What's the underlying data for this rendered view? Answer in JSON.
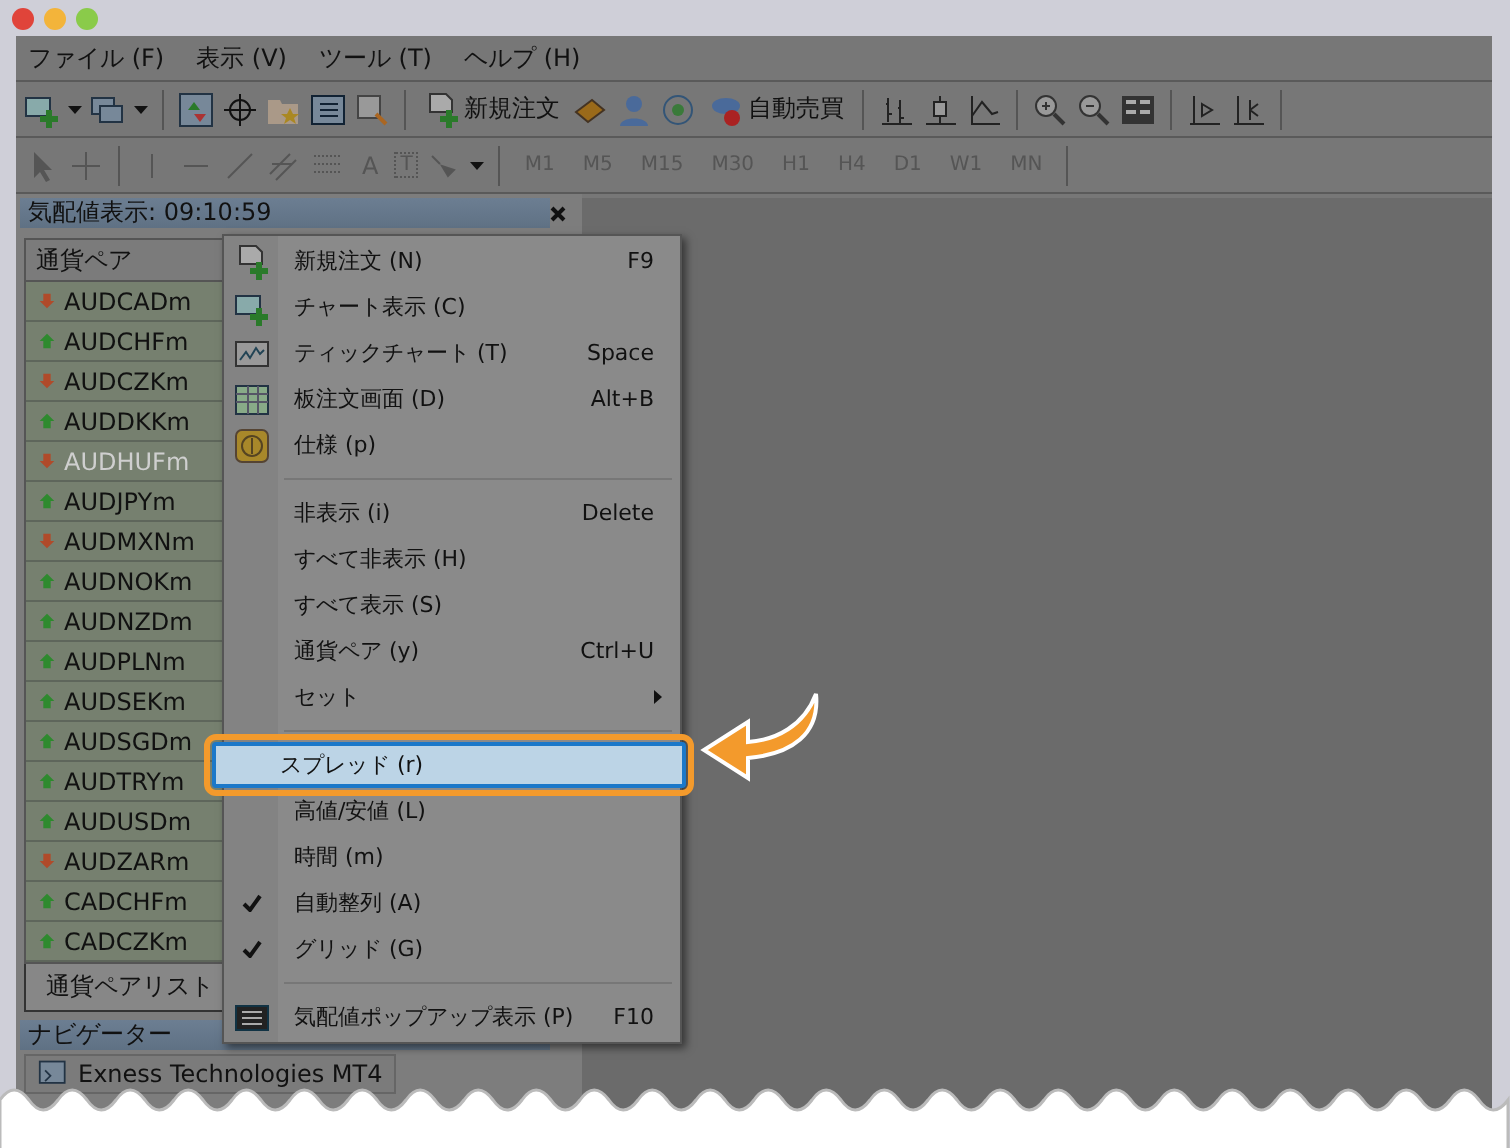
{
  "menu_bar": [
    "ファイル (F)",
    "表示 (V)",
    "ツール (T)",
    "ヘルプ (H)"
  ],
  "toolbar": {
    "new_order": "新規注文",
    "auto_trading": "自動売買"
  },
  "drawing_toolbar": {
    "text_tool": "A",
    "label_tool": "T"
  },
  "timeframes": [
    {
      "label": "M1",
      "disabled": true
    },
    {
      "label": "M5",
      "disabled": true
    },
    {
      "label": "M15",
      "disabled": true
    },
    {
      "label": "M30",
      "disabled": true
    },
    {
      "label": "H1",
      "disabled": true
    },
    {
      "label": "H4",
      "disabled": true
    },
    {
      "label": "D1",
      "disabled": true
    },
    {
      "label": "W1",
      "disabled": true
    },
    {
      "label": "MN",
      "disabled": true
    }
  ],
  "market_watch": {
    "title": "気配値表示: 09:10:59",
    "column": "通貨ペア",
    "rows": [
      {
        "symbol": "AUDCADm",
        "up": false,
        "disabled": false
      },
      {
        "symbol": "AUDCHFm",
        "up": true,
        "disabled": false
      },
      {
        "symbol": "AUDCZKm",
        "up": false,
        "disabled": false
      },
      {
        "symbol": "AUDDKKm",
        "up": true,
        "disabled": false
      },
      {
        "symbol": "AUDHUFm",
        "up": false,
        "disabled": true
      },
      {
        "symbol": "AUDJPYm",
        "up": true,
        "disabled": false
      },
      {
        "symbol": "AUDMXNm",
        "up": false,
        "disabled": false
      },
      {
        "symbol": "AUDNOKm",
        "up": true,
        "disabled": false
      },
      {
        "symbol": "AUDNZDm",
        "up": true,
        "disabled": false
      },
      {
        "symbol": "AUDPLNm",
        "up": true,
        "disabled": false
      },
      {
        "symbol": "AUDSEKm",
        "up": true,
        "disabled": false
      },
      {
        "symbol": "AUDSGDm",
        "up": true,
        "disabled": false
      },
      {
        "symbol": "AUDTRYm",
        "up": true,
        "disabled": false
      },
      {
        "symbol": "AUDUSDm",
        "up": true,
        "disabled": false
      },
      {
        "symbol": "AUDZARm",
        "up": false,
        "disabled": false
      },
      {
        "symbol": "CADCHFm",
        "up": true,
        "disabled": false
      },
      {
        "symbol": "CADCZKm",
        "up": true,
        "disabled": false
      }
    ],
    "tabs": [
      {
        "label": "通貨ペアリスト",
        "selected": true
      }
    ]
  },
  "navigator": {
    "title": "ナビゲーター",
    "items": [
      "Exness Technologies MT4"
    ]
  },
  "context_menu": [
    {
      "kind": "item",
      "label": "新規注文 (N)",
      "shortcut": "F9",
      "checked": false,
      "selected": false,
      "submenu": false
    },
    {
      "kind": "item",
      "label": "チャート表示 (C)",
      "checked": false,
      "selected": false,
      "submenu": false
    },
    {
      "kind": "item",
      "label": "ティックチャート (T)",
      "shortcut": "Space",
      "checked": false,
      "selected": false,
      "submenu": false
    },
    {
      "kind": "item",
      "label": "板注文画面 (D)",
      "shortcut": "Alt+B",
      "checked": false,
      "selected": false,
      "submenu": false
    },
    {
      "kind": "item",
      "label": "仕様 (p)",
      "checked": false,
      "selected": false,
      "submenu": false
    },
    {
      "kind": "separator"
    },
    {
      "kind": "item",
      "label": "非表示 (i)",
      "shortcut": "Delete",
      "checked": false,
      "selected": false,
      "submenu": false
    },
    {
      "kind": "item",
      "label": "すべて非表示 (H)",
      "checked": false,
      "selected": false,
      "submenu": false
    },
    {
      "kind": "item",
      "label": "すべて表示 (S)",
      "checked": false,
      "selected": false,
      "submenu": false
    },
    {
      "kind": "item",
      "label": "通貨ペア (y)",
      "shortcut": "Ctrl+U",
      "checked": false,
      "selected": false,
      "submenu": false
    },
    {
      "kind": "item",
      "label": "セット",
      "checked": false,
      "selected": false,
      "submenu": true
    },
    {
      "kind": "separator"
    },
    {
      "kind": "item",
      "label": "スプレッド (r)",
      "checked": false,
      "selected": true,
      "submenu": false
    },
    {
      "kind": "item",
      "label": "高値/安値 (L)",
      "checked": false,
      "selected": false,
      "submenu": false
    },
    {
      "kind": "item",
      "label": "時間 (m)",
      "checked": false,
      "selected": false,
      "submenu": false
    },
    {
      "kind": "item",
      "label": "自動整列 (A)",
      "checked": true,
      "selected": false,
      "submenu": false
    },
    {
      "kind": "item",
      "label": "グリッド (G)",
      "checked": true,
      "selected": false,
      "submenu": false
    },
    {
      "kind": "separator"
    },
    {
      "kind": "item",
      "label": "気配値ポップアップ表示 (P)",
      "shortcut": "F10",
      "checked": false,
      "selected": false,
      "submenu": false
    }
  ]
}
